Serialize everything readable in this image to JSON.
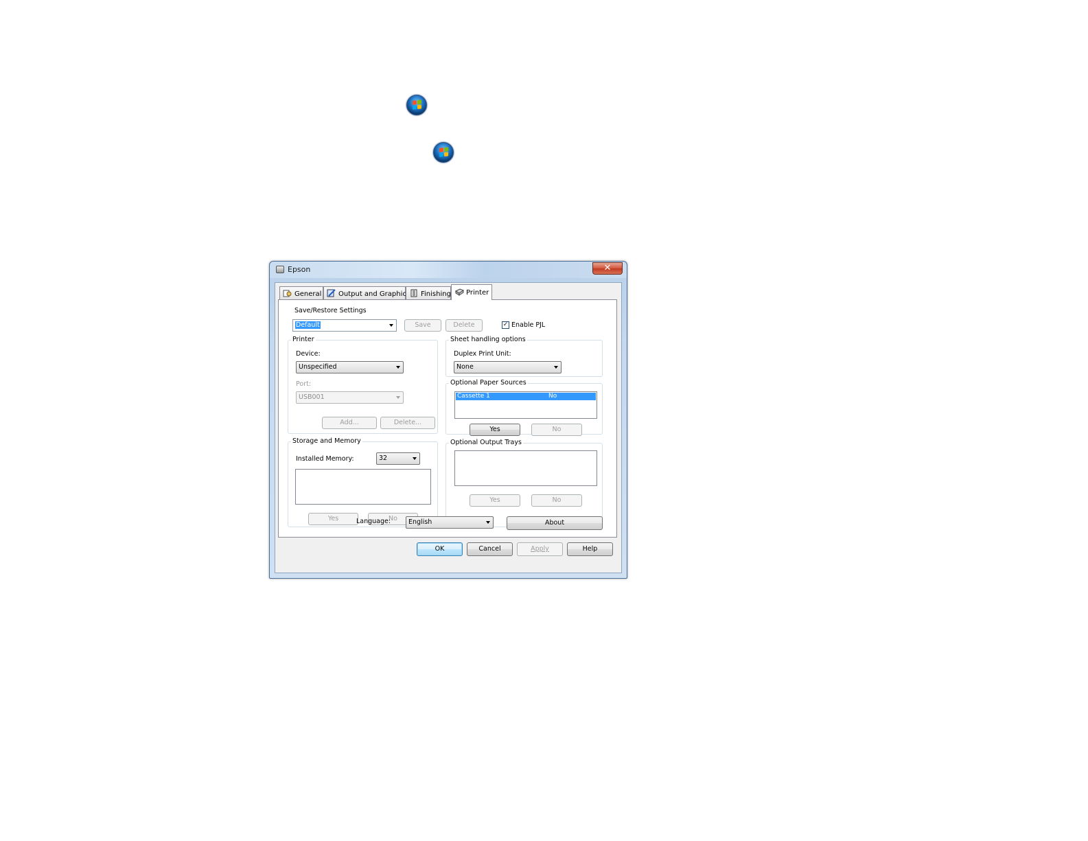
{
  "window": {
    "title": "Epson",
    "close_glyph": "✕"
  },
  "tabs": [
    {
      "label": "General",
      "icon": "general-tab-icon"
    },
    {
      "label": "Output and Graphics",
      "icon": "output-graphics-tab-icon"
    },
    {
      "label": "Finishing",
      "icon": "finishing-tab-icon"
    },
    {
      "label": "Printer",
      "icon": "printer-tab-icon",
      "active": true
    }
  ],
  "save_restore": {
    "legend": "Save/Restore Settings",
    "value": "Default",
    "save_label": "Save",
    "delete_label": "Delete"
  },
  "enable_pjl": {
    "label": "Enable PJL",
    "checked": true,
    "glyph": "✓"
  },
  "printer_group": {
    "legend": "Printer",
    "device_label": "Device:",
    "device_value": "Unspecified",
    "port_label": "Port:",
    "port_value": "USB001",
    "add_label": "Add...",
    "delete_label": "Delete..."
  },
  "sheet_handling": {
    "legend": "Sheet handling options",
    "duplex_label": "Duplex Print Unit:",
    "duplex_value": "None"
  },
  "paper_sources": {
    "legend": "Optional Paper Sources",
    "items": [
      {
        "name": "Cassette 1",
        "value": "No"
      }
    ],
    "yes_label": "Yes",
    "no_label": "No"
  },
  "storage": {
    "legend": "Storage and Memory",
    "memory_label": "Installed Memory:",
    "memory_value": "32",
    "yes_label": "Yes",
    "no_label": "No"
  },
  "output_trays": {
    "legend": "Optional Output Trays",
    "yes_label": "Yes",
    "no_label": "No"
  },
  "language": {
    "label": "Language:",
    "value": "English",
    "about_label": "About"
  },
  "footer": {
    "ok_label": "OK",
    "cancel_label": "Cancel",
    "apply_label": "Apply",
    "help_label": "Help"
  },
  "colors": {
    "selection": "#3399ff",
    "titlebar": "#c9dcf0",
    "close_button": "#d2553b"
  }
}
